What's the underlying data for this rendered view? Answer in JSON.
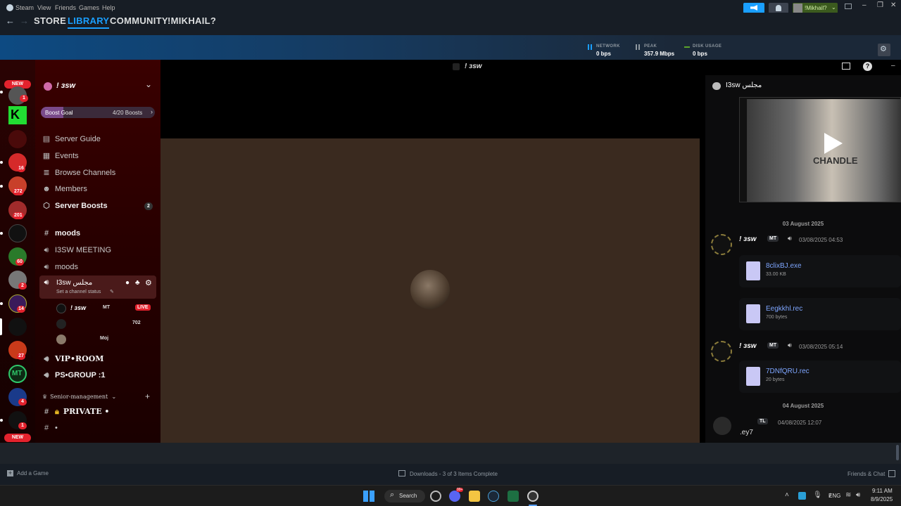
{
  "steam": {
    "menu": [
      "Steam",
      "View",
      "Friends",
      "Games",
      "Help"
    ],
    "nav": {
      "store": "STORE",
      "library": "LIBRARY",
      "community": "COMMUNITY",
      "user": "!MIKHAIL?"
    },
    "account_name": "!Mikhail?",
    "stats": {
      "network_label": "NETWORK",
      "network_value": "0 bps",
      "peak_label": "PEAK",
      "peak_value": "357.9 Mbps",
      "disk_label": "DISK USAGE",
      "disk_value": "0 bps"
    },
    "footer": {
      "add_game": "Add a Game",
      "downloads": "Downloads - 3 of 3 Items Complete",
      "friends_chat": "Friends & Chat"
    }
  },
  "discord": {
    "stream_title": "! зѕw",
    "server_name": "! зѕw",
    "boost_goal_label": "Boost Goal",
    "boost_goal_value": "4/20 Boosts",
    "nav_items": [
      "Server Guide",
      "Events",
      "Browse Channels",
      "Members",
      "Server Boosts"
    ],
    "server_boosts_count": "2",
    "channels": {
      "moods_text": "moods",
      "meeting": "I3SW MEETING",
      "moods_voice": "moods",
      "active_voice": "I3sw مجلس",
      "channel_status": "Set a channel status",
      "vip_room": "VIP•ROOM",
      "ps_group": "PS•GROUP :1",
      "category_senior": "Senior-management",
      "private": "PRIVATE •",
      "hash_only": "•"
    },
    "voice_users": [
      {
        "name": "! зѕw",
        "tag": "MT",
        "badge": "LIVE"
      },
      {
        "name": "",
        "tag": "702",
        "badge": ""
      },
      {
        "name": "",
        "tag": "Moj",
        "badge": ""
      }
    ],
    "server_badges": {
      "new_top": "NEW",
      "b1": "1",
      "b16": "16",
      "b272": "272",
      "b201": "201",
      "b60": "60",
      "b2": "2",
      "b14": "14",
      "b27": "27",
      "b4": "4",
      "b1b": "1",
      "new_bottom": "NEW",
      "mt_label": "MT",
      "k_label": "K"
    },
    "chat": {
      "channel_name": "I3sw مجلس",
      "date1": "03 August 2025",
      "msg1_name": "! зѕw",
      "msg1_tag": "MT",
      "msg1_time": "03/08/2025 04:53",
      "file1_name": "8clixBJ.exe",
      "file1_size": "33.00 KB",
      "file2_name": "Eegkkhl.rec",
      "file2_size": "700 bytes",
      "msg2_name": "! зѕw",
      "msg2_tag": "MT",
      "msg2_time": "03/08/2025 05:14",
      "file3_name": "7DNfQRU.rec",
      "file3_size": "20 bytes",
      "date2": "04 August 2025",
      "msg3_tag": "TL",
      "msg3_time": "04/08/2025 12:07",
      "msg3_text": ".ey7",
      "video_text": "CHANDLE"
    }
  },
  "taskbar": {
    "search": "Search",
    "lang": "ENG",
    "time": "9:11 AM",
    "date": "8/9/2025",
    "discord_badge": "99+"
  },
  "colors": {
    "steam_accent": "#1a9fff",
    "discord_red": "#e3222d",
    "link_blue": "#7ea6ff"
  }
}
